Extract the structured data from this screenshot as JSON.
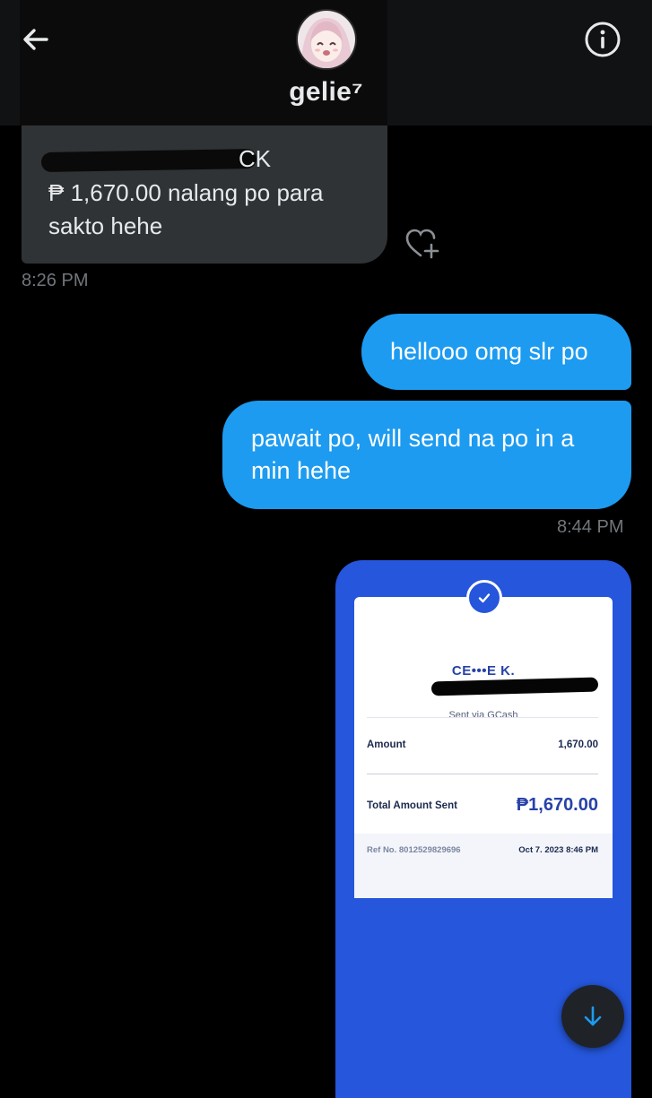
{
  "header": {
    "display_name": "gelie⁷",
    "icons": {
      "back": "back-arrow-icon",
      "info": "info-icon"
    }
  },
  "conversation": {
    "incoming": {
      "line1": "CK",
      "line2": "₱ 1,670.00 nalang po para",
      "line3": "sakto hehe",
      "time": "8:26 PM"
    },
    "outgoing": [
      {
        "text": "hellooo omg slr po"
      },
      {
        "line1": "pawait po, will send na po in a",
        "line2": "min hehe"
      }
    ],
    "outgoing_time": "8:44 PM"
  },
  "receipt": {
    "recipient": "CE•••E K.",
    "via": "Sent via GCash",
    "amount_label": "Amount",
    "amount_value": "1,670.00",
    "total_label": "Total Amount Sent",
    "total_value": "₱1,670.00",
    "ref_label": "Ref No. 8012529829696",
    "date": "Oct 7, 2023 8:46 PM"
  },
  "colors": {
    "outgoing_bubble": "#1d9bf0",
    "incoming_bubble": "#2f3336",
    "receipt_blue": "#2556db",
    "background": "#000000"
  }
}
